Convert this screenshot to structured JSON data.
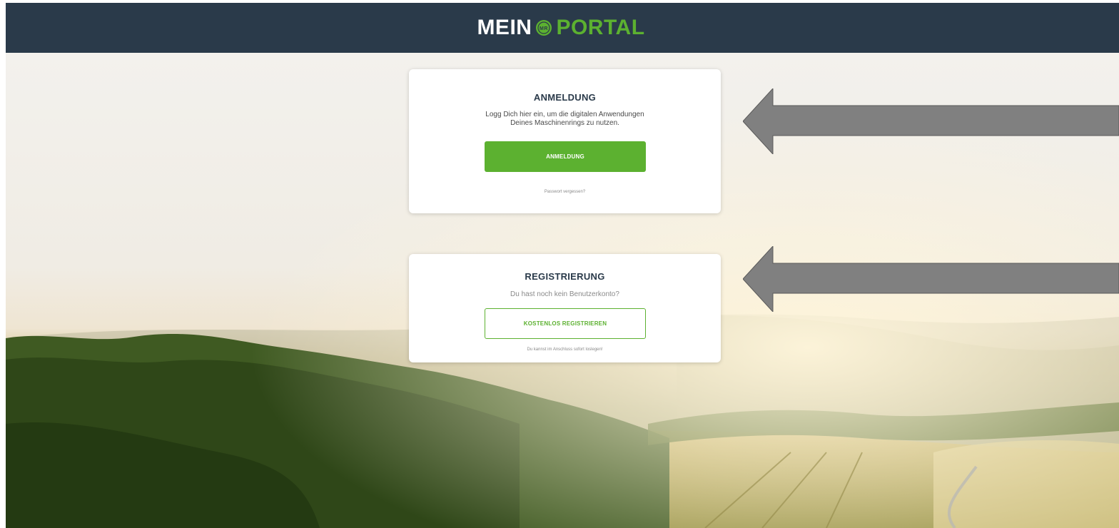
{
  "header": {
    "logo_left": "MEIN",
    "logo_badge": "MR",
    "logo_right": "PORTAL"
  },
  "login": {
    "title": "ANMELDUNG",
    "text_line1": "Logg Dich hier ein, um die digitalen Anwendungen",
    "text_line2": "Deines Maschinenrings zu nutzen.",
    "button_label": "ANMELDUNG",
    "forgot_link": "Passwort vergessen?"
  },
  "register": {
    "title": "REGISTRIERUNG",
    "text": "Du hast noch kein Benutzerkonto?",
    "button_label": "KOSTENLOS REGISTRIEREN",
    "note": "Du kannst im Anschluss sofort loslegen!"
  },
  "colors": {
    "header_bg": "#2a3a4a",
    "brand_green": "#5cb130",
    "arrow": "#808080"
  },
  "icons": [
    "mr-badge-icon",
    "arrow-left-icon"
  ]
}
